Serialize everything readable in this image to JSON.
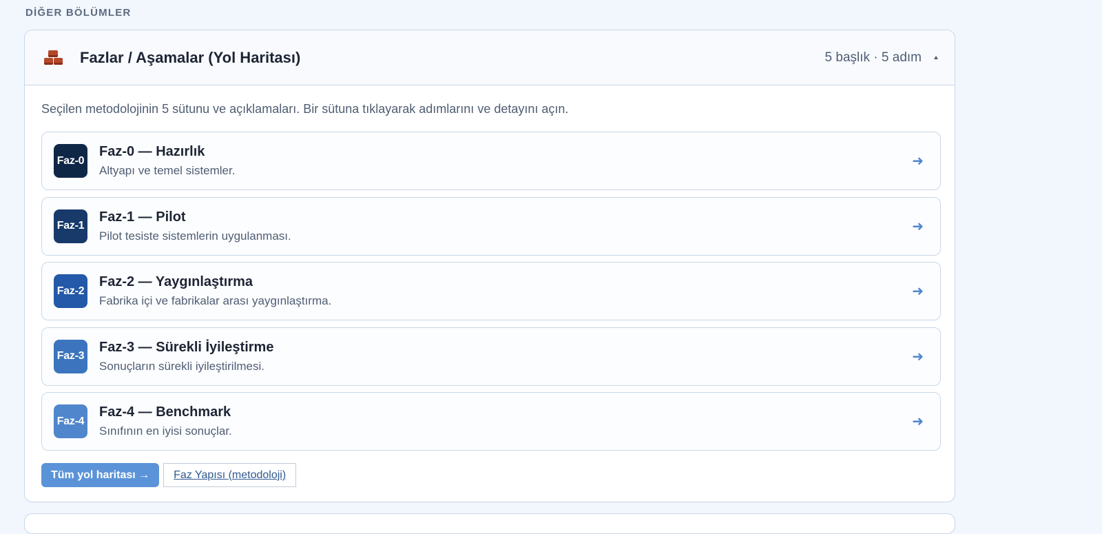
{
  "section": {
    "label": "DİĞER BÖLÜMLER"
  },
  "card": {
    "icon": "brick-icon",
    "title": "Fazlar / Aşamalar (Yol Haritası)",
    "meta": "5 başlık · 5 adım",
    "description": "Seçilen metodolojinin 5 sütunu ve açıklamaları. Bir sütuna tıklayarak adımlarını ve detayını açın.",
    "phases": [
      {
        "badge": "Faz-0",
        "title": "Faz-0 — Hazırlık",
        "subtitle": "Altyapı ve temel sistemler.",
        "color": "#0f2747"
      },
      {
        "badge": "Faz-1",
        "title": "Faz-1 — Pilot",
        "subtitle": "Pilot tesiste sistemlerin uygulanması.",
        "color": "#173a6b"
      },
      {
        "badge": "Faz-2",
        "title": "Faz-2 — Yaygınlaştırma",
        "subtitle": "Fabrika içi ve fabrikalar arası yaygınlaştırma.",
        "color": "#2458a8"
      },
      {
        "badge": "Faz-3",
        "title": "Faz-3 — Sürekli İyileştirme",
        "subtitle": "Sonuçların sürekli iyileştirilmesi.",
        "color": "#3c75bd"
      },
      {
        "badge": "Faz-4",
        "title": "Faz-4 — Benchmark",
        "subtitle": "Sınıfının en iyisi sonuçlar.",
        "color": "#4f86cc"
      }
    ],
    "primary_button": "Tüm yol haritası →",
    "secondary_link": "Faz Yapısı (metodoloji)"
  },
  "colors": {
    "accent": "#5b93d8",
    "arrow": "#4e86cf"
  }
}
